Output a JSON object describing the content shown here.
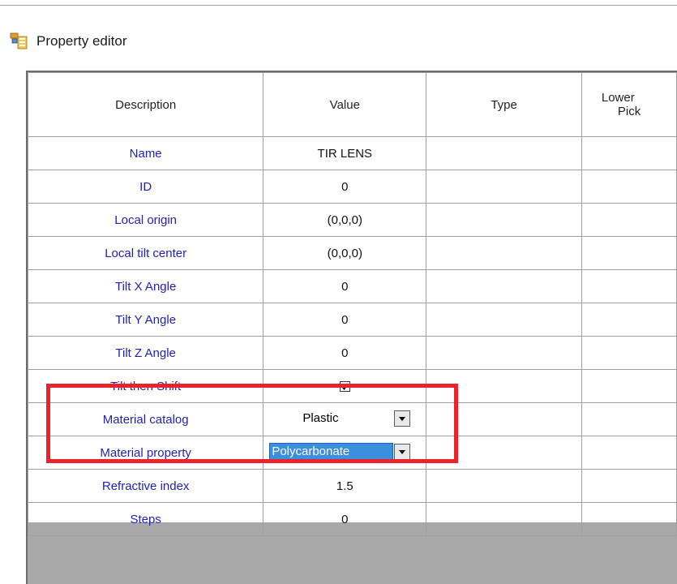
{
  "window": {
    "title": "Property editor"
  },
  "grid": {
    "headers": {
      "description": "Description",
      "value": "Value",
      "type": "Type",
      "lower_line1": "Lower",
      "lower_line2": "Pick"
    },
    "rows": [
      {
        "description": "Name",
        "value": "TIR LENS"
      },
      {
        "description": "ID",
        "value": "0"
      },
      {
        "description": "Local origin",
        "value": "(0,0,0)"
      },
      {
        "description": "Local tilt center",
        "value": "(0,0,0)"
      },
      {
        "description": "Tilt X Angle",
        "value": "0"
      },
      {
        "description": "Tilt Y Angle",
        "value": "0"
      },
      {
        "description": "Tilt Z Angle",
        "value": "0"
      },
      {
        "description": "Tilt then Shift",
        "value_checked": true
      },
      {
        "description": "Material catalog",
        "value": "Plastic"
      },
      {
        "description": "Material property",
        "value": "Polycarbonate"
      },
      {
        "description": "Refractive index",
        "value": "1.5"
      },
      {
        "description": "Steps",
        "value": "0"
      }
    ]
  },
  "colors": {
    "highlight_border": "#e8232b",
    "description_text": "#1f1fb8",
    "selection": "#3b8fdf"
  }
}
